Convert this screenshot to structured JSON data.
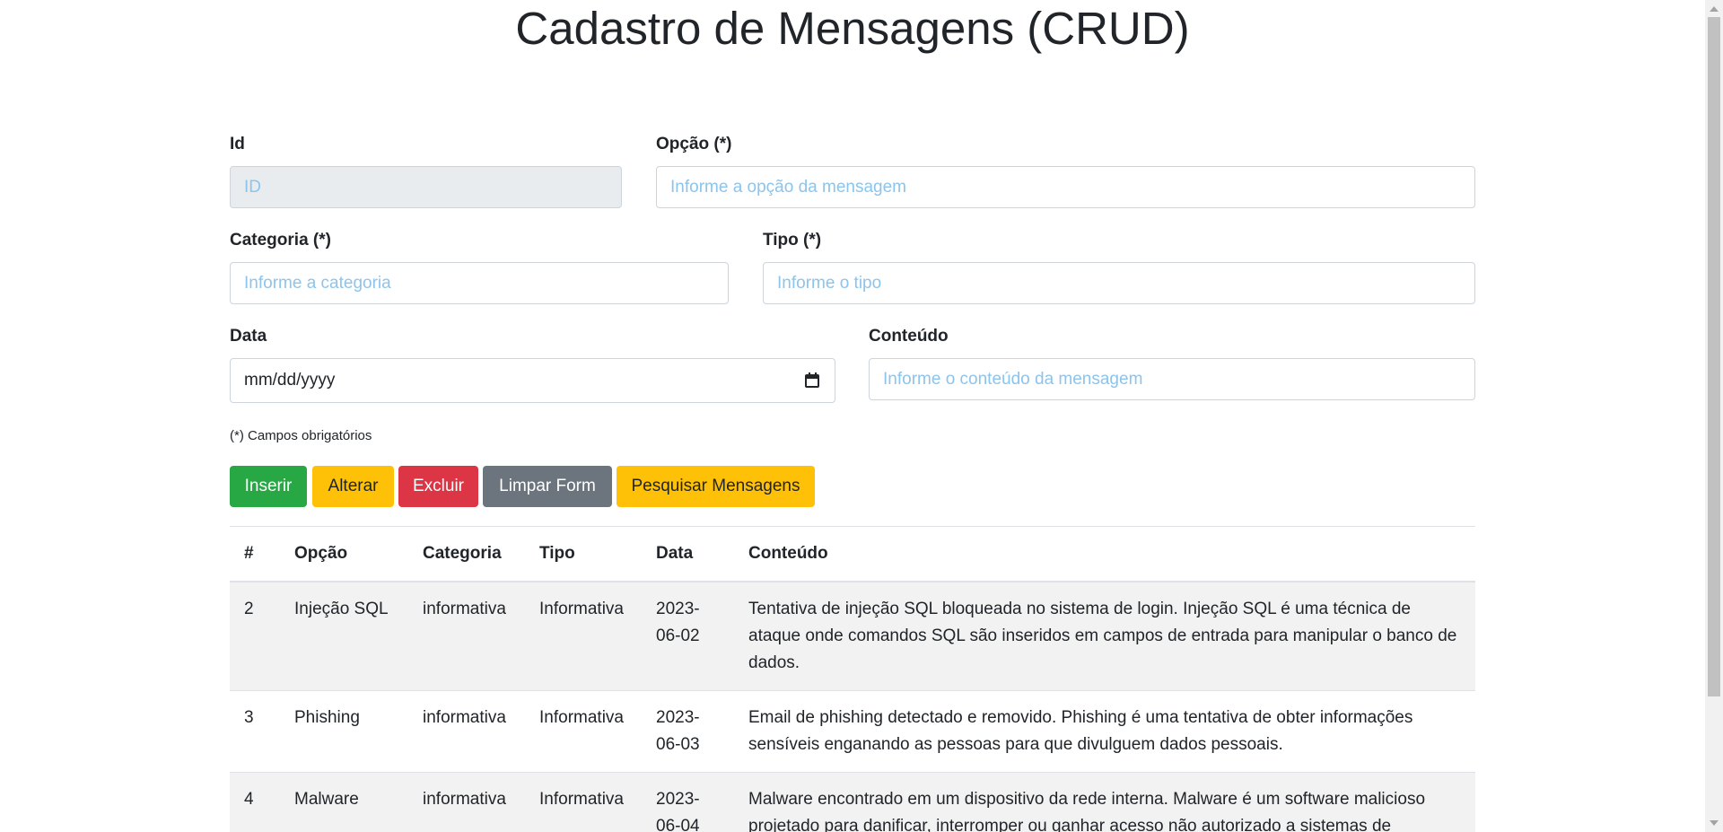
{
  "page_title": "Cadastro de Mensagens (CRUD)",
  "form": {
    "id": {
      "label": "Id",
      "placeholder": "ID"
    },
    "opcao": {
      "label": "Opção (*)",
      "placeholder": "Informe a opção da mensagem"
    },
    "categoria": {
      "label": "Categoria (*)",
      "placeholder": "Informe a categoria"
    },
    "tipo": {
      "label": "Tipo (*)",
      "placeholder": "Informe o tipo"
    },
    "data": {
      "label": "Data",
      "value": "mm/dd/yyyy"
    },
    "conteudo": {
      "label": "Conteúdo",
      "placeholder": "Informe o conteúdo da mensagem"
    },
    "required_hint": "(*) Campos obrigatórios"
  },
  "buttons": {
    "inserir": "Inserir",
    "alterar": "Alterar",
    "excluir": "Excluir",
    "limpar": "Limpar Form",
    "pesquisar": "Pesquisar Mensagens"
  },
  "colors": {
    "success": "#28a745",
    "warning": "#ffc107",
    "danger": "#dc3545",
    "secondary": "#6c757d",
    "placeholder": "#8cc4ec"
  },
  "table": {
    "headers": [
      "#",
      "Opção",
      "Categoria",
      "Tipo",
      "Data",
      "Conteúdo"
    ],
    "rows": [
      {
        "id": "2",
        "opcao": "Injeção SQL",
        "categoria": "informativa",
        "tipo": "Informativa",
        "data_line1": "2023-",
        "data_line2": "06-02",
        "conteudo": "Tentativa de injeção SQL bloqueada no sistema de login. Injeção SQL é uma técnica de ataque onde comandos SQL são inseridos em campos de entrada para manipular o banco de dados."
      },
      {
        "id": "3",
        "opcao": "Phishing",
        "categoria": "informativa",
        "tipo": "Informativa",
        "data_line1": "2023-",
        "data_line2": "06-03",
        "conteudo": "Email de phishing detectado e removido. Phishing é uma tentativa de obter informações sensíveis enganando as pessoas para que divulguem dados pessoais."
      },
      {
        "id": "4",
        "opcao": "Malware",
        "categoria": "informativa",
        "tipo": "Informativa",
        "data_line1": "2023-",
        "data_line2": "06-04",
        "conteudo": "Malware encontrado em um dispositivo da rede interna. Malware é um software malicioso projetado para danificar, interromper ou ganhar acesso não autorizado a sistemas de"
      }
    ]
  }
}
